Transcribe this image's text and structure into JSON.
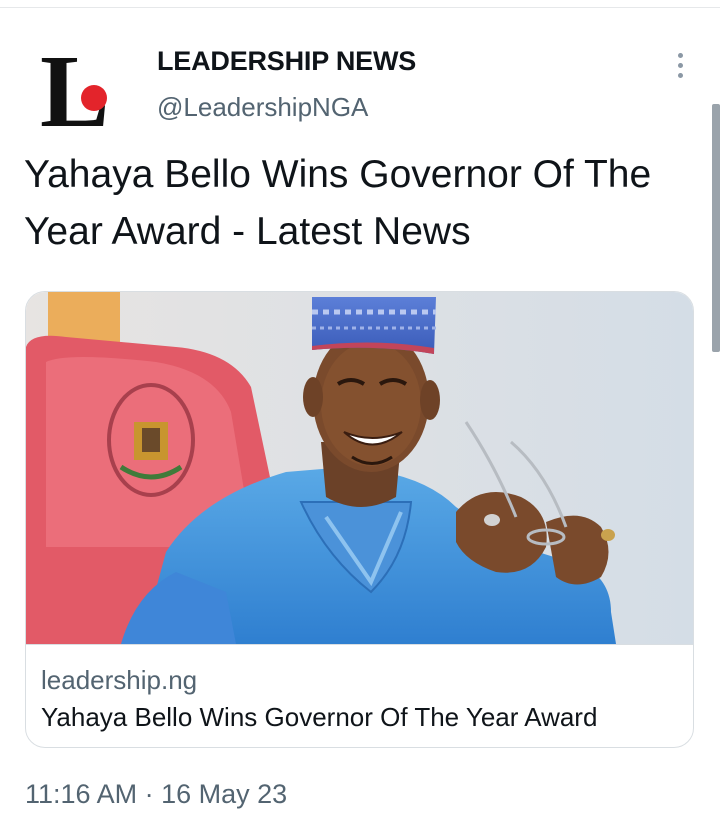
{
  "account": {
    "display_name": "LEADERSHIP NEWS",
    "handle": "@LeadershipNGA",
    "avatar_letter": "L",
    "avatar_icon": "leadership-logo-icon",
    "brand_dot_color": "#e3242b"
  },
  "tweet": {
    "text": "Yahaya Bello Wins Governor Of The Year Award - Latest News"
  },
  "link_card": {
    "domain": "leadership.ng",
    "title": "Yahaya Bello Wins Governor Of The Year Award",
    "image_icon": "article-photo"
  },
  "meta": {
    "time": "11:16 AM",
    "separator": "·",
    "date": "16 May 23"
  },
  "menu": {
    "icon": "more-vertical-icon"
  }
}
